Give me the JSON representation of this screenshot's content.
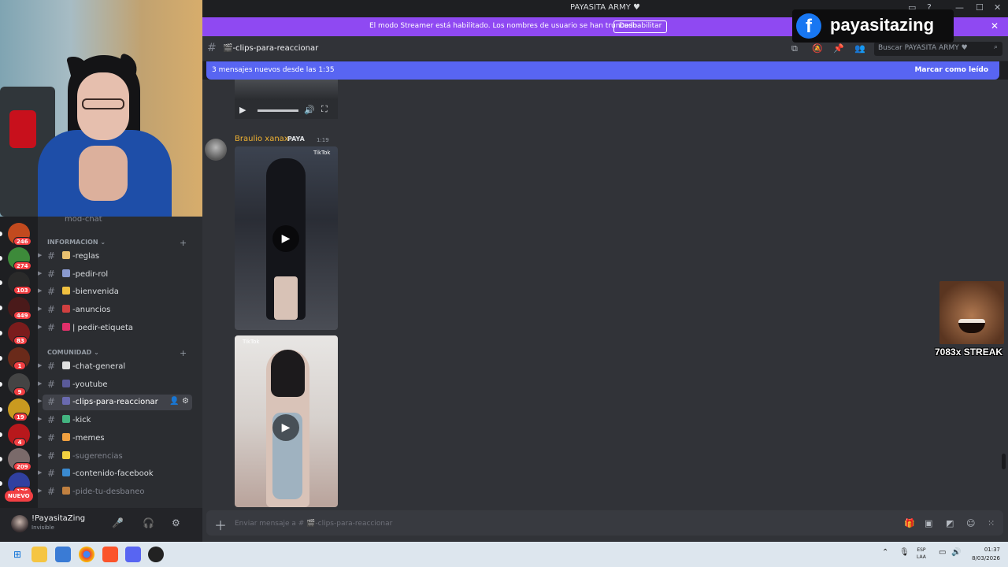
{
  "window": {
    "title": "PAYASITA ARMY ♥",
    "controls": [
      "—",
      "☐",
      "✕"
    ]
  },
  "banner": {
    "message": "El modo Streamer está habilitado. Los nombres de usuario se han truncado.",
    "button": "Deshabilitar"
  },
  "channel_header": {
    "name": "🎬-clips-para-reaccionar",
    "search_placeholder": "Buscar PAYASITA ARMY ♥"
  },
  "new_messages": {
    "text": "3 mensajes nuevos desde las 1:35",
    "mark_read": "Marcar como leído"
  },
  "message": {
    "author": "Braulio xanax",
    "role_tag": "PAYA",
    "time": "1:19",
    "tiktok_label": "TikTok"
  },
  "composer": {
    "placeholder": "Enviar mensaje a # 🎬-clips-para-reaccionar"
  },
  "servers": [
    {
      "badge": "246",
      "color": "#c24a1e"
    },
    {
      "badge": "274",
      "color": "#3d8a3a"
    },
    {
      "badge": "103",
      "color": "#2a2a2a"
    },
    {
      "badge": "449",
      "color": "#4a1a1a"
    },
    {
      "badge": "83",
      "color": "#7a1c1c"
    },
    {
      "badge": "1",
      "color": "#6a2a1a"
    },
    {
      "badge": "9",
      "color": "#444444"
    },
    {
      "badge": "19",
      "color": "#c99a20"
    },
    {
      "badge": "4",
      "color": "#b8181c"
    },
    {
      "badge": "209",
      "color": "#7a6a6a"
    },
    {
      "badge": "176",
      "color": "#3040a0"
    }
  ],
  "new_badge": "NUEVO",
  "sidebar": {
    "top_channel": "mod-chat",
    "categories": [
      {
        "name": "INFORMACION",
        "channels": [
          {
            "name": "-reglas",
            "muted": false,
            "emoji_color": "#e8c070"
          },
          {
            "name": "-pedir-rol",
            "muted": false,
            "emoji_color": "#8a9ad0"
          },
          {
            "name": "-bienvenida",
            "muted": false,
            "emoji_color": "#f0c040"
          },
          {
            "name": "-anuncios",
            "muted": false,
            "emoji_color": "#d04040"
          },
          {
            "name": "| pedir-etiqueta",
            "muted": false,
            "emoji_color": "#e0306a"
          }
        ]
      },
      {
        "name": "COMUNIDAD",
        "channels": [
          {
            "name": "-chat-general",
            "muted": false,
            "emoji_color": "#e0e0e0"
          },
          {
            "name": "-youtube",
            "muted": false,
            "emoji_color": "#5a5a9a"
          },
          {
            "name": "-clips-para-reaccionar",
            "muted": false,
            "emoji_color": "#6a6ab0"
          },
          {
            "name": "-kick",
            "muted": false,
            "emoji_color": "#43b581"
          },
          {
            "name": "-memes",
            "muted": false,
            "emoji_color": "#f0a040"
          },
          {
            "name": "-sugerencias",
            "muted": true,
            "emoji_color": "#f0d040"
          },
          {
            "name": "-contenido-facebook",
            "muted": false,
            "emoji_color": "#3a8ad0"
          },
          {
            "name": "-pide-tu-desbaneo",
            "muted": true,
            "emoji_color": "#c08040"
          }
        ]
      }
    ]
  },
  "user": {
    "name": "!PayasitaZing",
    "status": "Invisible"
  },
  "overlay": {
    "facebook_logo": "f",
    "facebook_name": "payasitazing",
    "streak": "7083x STREAK"
  },
  "taskbar": {
    "lang_line1": "ESP",
    "lang_line2": "LAA",
    "time": "01:37",
    "date": "8/03/2026"
  },
  "colors": {
    "accent": "#5865f2",
    "streamer_banner": "#8f49f2",
    "author": "#f0b232",
    "badge": "#f23f43"
  }
}
